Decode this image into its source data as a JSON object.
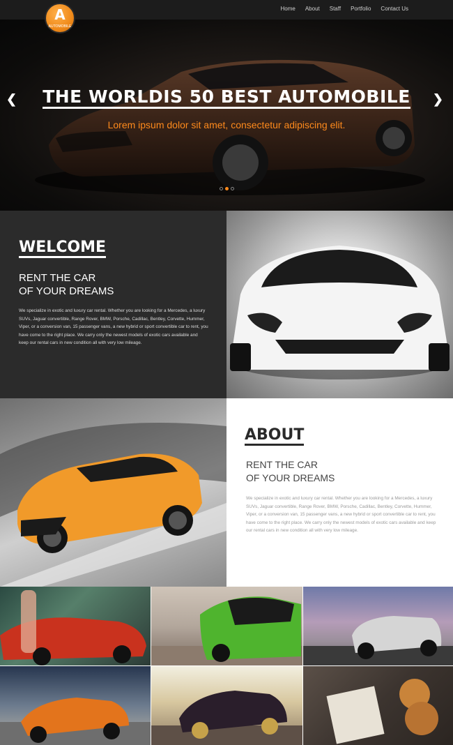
{
  "logo": {
    "letter": "A",
    "subtext": "AUTOMOBILE"
  },
  "nav": {
    "items": [
      "Home",
      "About",
      "Staff",
      "Portfolio",
      "Contact Us"
    ]
  },
  "hero": {
    "title": "THE WORLDIS 50 BEST AUTOMOBILE",
    "subtitle": "Lorem ipsum dolor sit amet, consectetur adipiscing elit.",
    "prev_arrow": "❮",
    "next_arrow": "❯",
    "slides": 3,
    "active_slide": 2
  },
  "welcome": {
    "heading": "WELCOME",
    "sub_line1": "RENT THE CAR",
    "sub_line2": "OF YOUR DREAMS",
    "text": "We specialize in exotic and luxury car rental. Whether you are looking for a Mercedes, a luxury SUVs, Jaguar convertible, Range Rover, BMW, Porsche, Cadillac, Bentley, Corvette, Hummer, Viper, or a conversion van, 15 passenger vans, a new hybrid or sport convertible car to rent, you have come to the right place. We carry only the newest models of exotic cars available and keep our rental cars in new condition all with very low mileage."
  },
  "about": {
    "heading": "ABOUT",
    "sub_line1": "RENT THE CAR",
    "sub_line2": "OF YOUR DREAMS",
    "text": "We specialize in exotic and luxury car rental. Whether you are looking for a Mercedes, a luxury SUVs, Jaguar convertible, Range Rover, BMW, Porsche, Cadillac, Bentley, Corvette, Hummer, Viper, or a conversion van, 15 passenger vans, a new hybrid or sport convertible car to rent, you have come to the right place. We carry only the newest models of exotic cars available and keep our rental cars in new condition all with very low mileage."
  },
  "colors": {
    "accent": "#ff8a1c",
    "dark": "#2b2b2b",
    "nav_bg": "#1c1c1c"
  }
}
